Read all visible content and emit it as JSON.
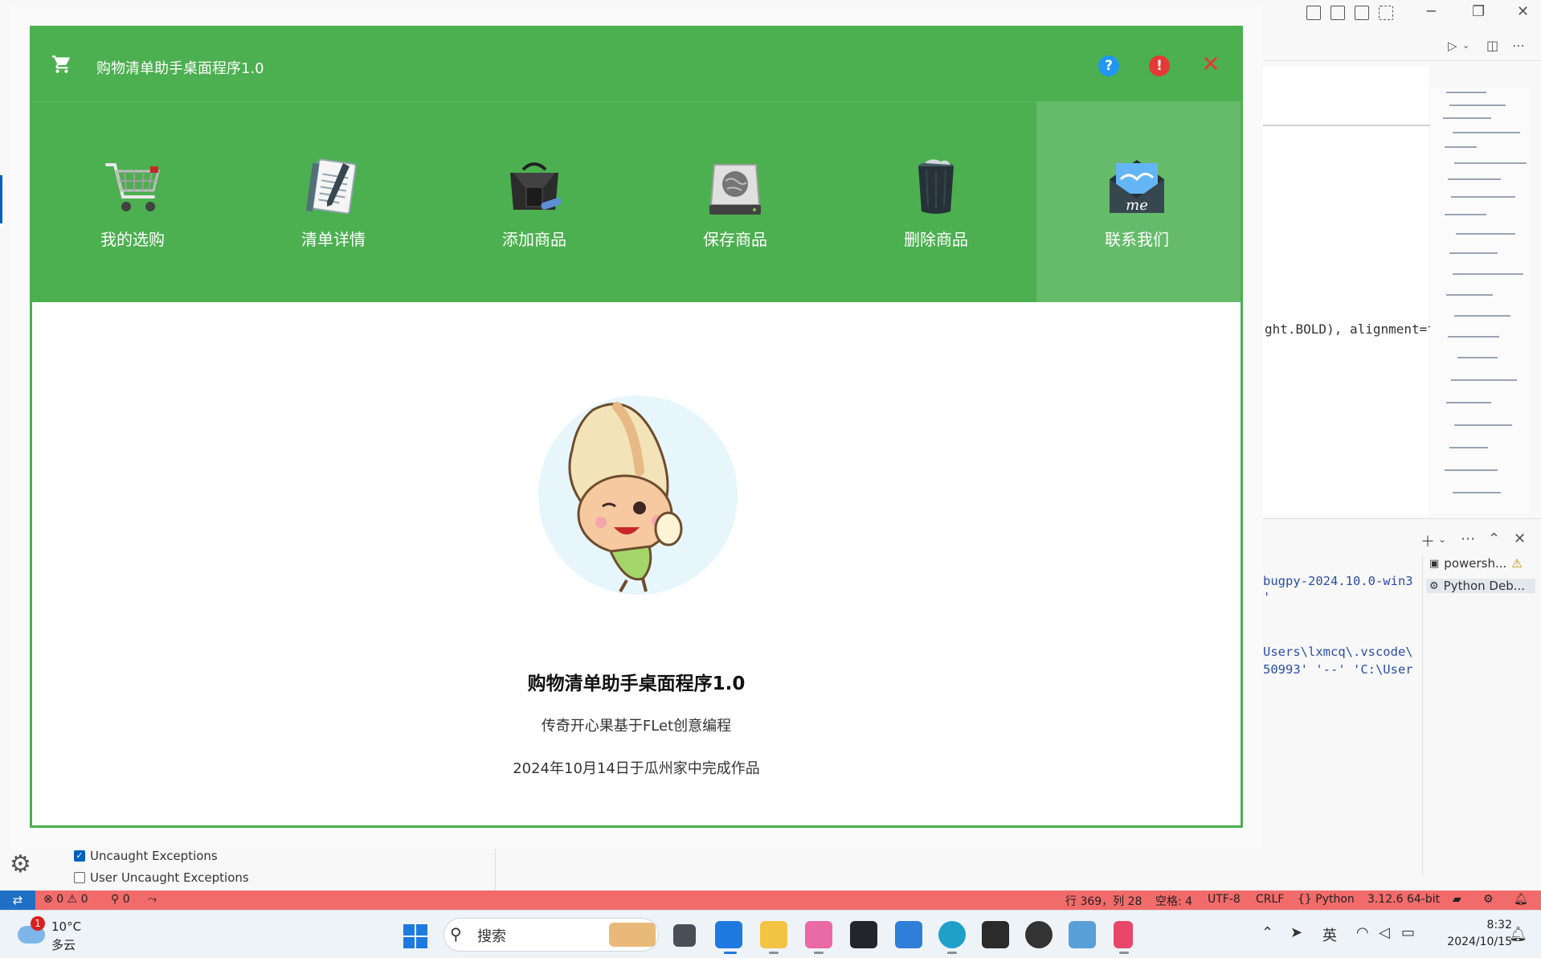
{
  "app": {
    "title": "购物清单助手桌面程序1.0",
    "nav": [
      {
        "label": "我的选购",
        "icon": "shopping-cart-icon"
      },
      {
        "label": "清单详情",
        "icon": "notepad-icon"
      },
      {
        "label": "添加商品",
        "icon": "shopping-bag-icon"
      },
      {
        "label": "保存商品",
        "icon": "save-drive-icon"
      },
      {
        "label": "删除商品",
        "icon": "trash-can-icon"
      },
      {
        "label": "联系我们",
        "icon": "mail-icon",
        "active": true
      }
    ],
    "about": {
      "title": "购物清单助手桌面程序1.0",
      "subtitle": "传奇开心果基于FLet创意编程",
      "date_text": "2024年10月14日于瓜州家中完成作品"
    },
    "colors": {
      "header": "#4caf50",
      "active_nav": "#66bb6a",
      "help": "#2196f3",
      "info": "#e53935",
      "close": "#e53935"
    }
  },
  "vscode": {
    "editor_code": "ght.BOLD), alignment=f",
    "terminal_lines": [
      "bugpy-2024.10.0-win3",
      "Users\\lxmcq\\.vscode\\",
      "50993' '--' 'C:\\User"
    ],
    "terminal_tabs": [
      "powersh...",
      "Python Deb..."
    ],
    "breakpoints": [
      {
        "label": "Uncaught Exceptions",
        "checked": true
      },
      {
        "label": "User Uncaught Exceptions",
        "checked": false
      }
    ],
    "statusbar": {
      "errors": "0",
      "warnings": "0",
      "ports": "0",
      "position": "行 369，列 28",
      "spaces": "空格: 4",
      "encoding": "UTF-8",
      "eol": "CRLF",
      "language": "{} Python",
      "interpreter": "3.12.6 64-bit"
    }
  },
  "taskbar": {
    "weather_temp": "10°C",
    "weather_desc": "多云",
    "weather_badge": "1",
    "search_placeholder": "搜索",
    "ime": "英",
    "time": "8:32",
    "date": "2024/10/15"
  }
}
